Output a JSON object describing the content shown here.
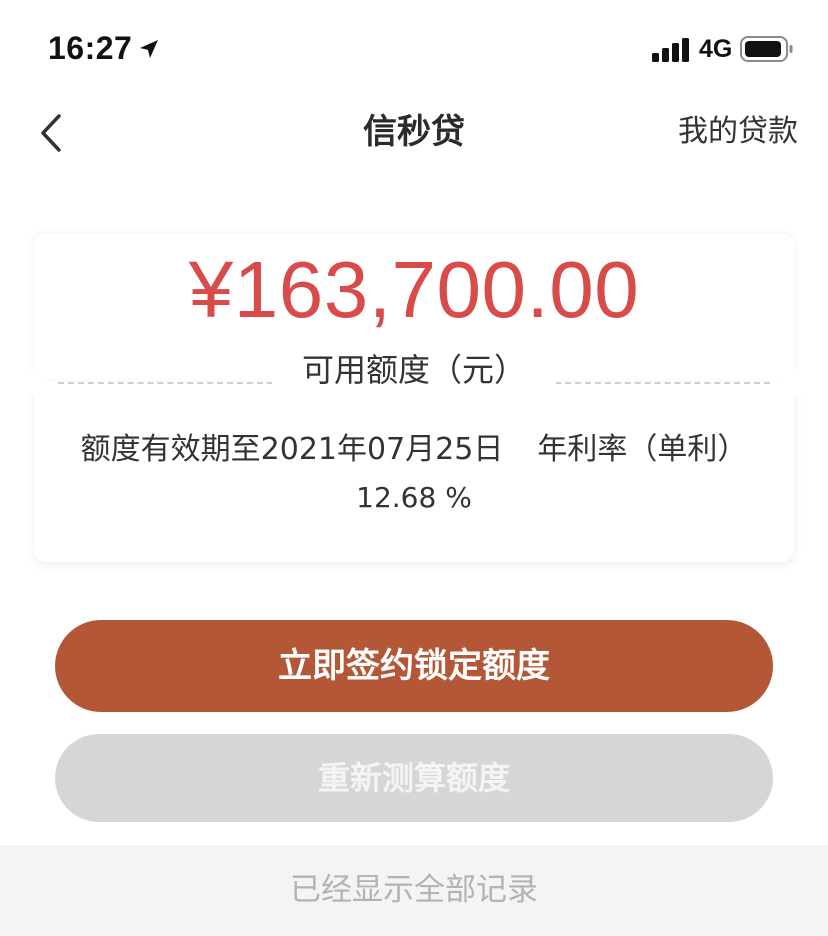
{
  "status_bar": {
    "time": "16:27",
    "network": "4G",
    "icons": [
      "location-arrow-icon",
      "signal-bars-icon",
      "battery-icon"
    ]
  },
  "nav": {
    "back_icon": "chevron-left-icon",
    "title": "信秒贷",
    "right_link": "我的贷款"
  },
  "credit": {
    "amount": "¥163,700.00",
    "amount_label": "可用额度（元）",
    "validity_text": "额度有效期至2021年07月25日",
    "rate_label": "年利率（单利）",
    "rate_value": "12.68 %"
  },
  "actions": {
    "primary_label": "立即签约锁定额度",
    "secondary_label": "重新测算额度"
  },
  "footer": {
    "text": "已经显示全部记录"
  },
  "colors": {
    "amount": "#d94a4a",
    "primary_button": "#b45737",
    "secondary_button": "#d6d6d6",
    "footer_background": "#f4f4f6",
    "footer_text": "#b3b3b3"
  }
}
